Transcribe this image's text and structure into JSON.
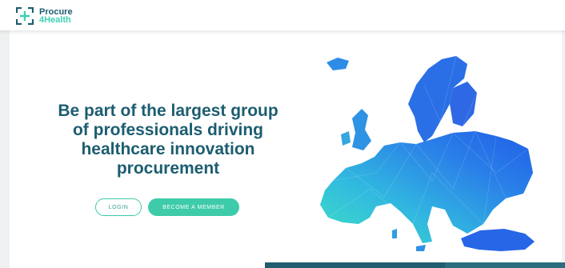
{
  "header": {
    "logo": {
      "line1": "Procure",
      "line2": "4Health"
    }
  },
  "hero": {
    "title": "Be part of the largest group of professionals driving healthcare innovation procurement",
    "login_label": "LOGIN",
    "member_label": "BECOME A MEMBER"
  },
  "colors": {
    "brand_dark": "#1c5d70",
    "brand_accent": "#3ecba9",
    "map_teal": "#3fe0c5",
    "map_blue": "#1f5ee8"
  }
}
